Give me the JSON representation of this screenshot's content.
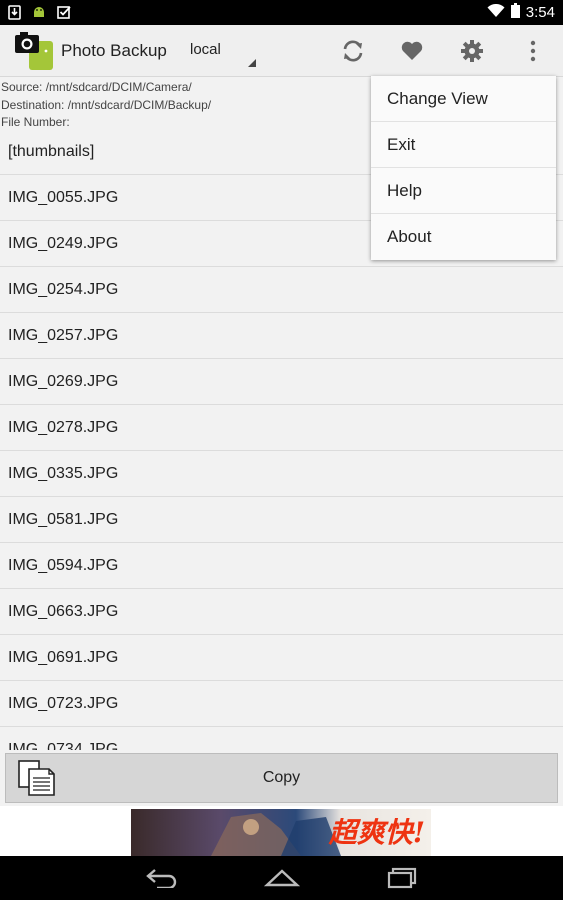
{
  "status_bar": {
    "time": "3:54"
  },
  "action_bar": {
    "title": "Photo Backup",
    "location_spinner": "local",
    "icons": [
      "refresh-icon",
      "heart-icon",
      "gear-icon",
      "overflow-menu-icon"
    ]
  },
  "info": {
    "source": "Source: /mnt/sdcard/DCIM/Camera/",
    "destination": "Destination: /mnt/sdcard/DCIM/Backup/",
    "file_number": "File Number:"
  },
  "files": [
    "[thumbnails]",
    "IMG_0055.JPG",
    "IMG_0249.JPG",
    "IMG_0254.JPG",
    "IMG_0257.JPG",
    "IMG_0269.JPG",
    "IMG_0278.JPG",
    "IMG_0335.JPG",
    "IMG_0581.JPG",
    "IMG_0594.JPG",
    "IMG_0663.JPG",
    "IMG_0691.JPG",
    "IMG_0723.JPG",
    "IMG_0734.JPG"
  ],
  "copy_button": {
    "label": "Copy"
  },
  "ad": {
    "text": "超爽快!"
  },
  "overflow_menu": {
    "items": [
      "Change View",
      "Exit",
      "Help",
      "About"
    ]
  },
  "colors": {
    "status_bar": "#000000",
    "action_bar": "#efefef",
    "list_bg": "#f2f2f2",
    "menu_bg": "#fafafa"
  }
}
